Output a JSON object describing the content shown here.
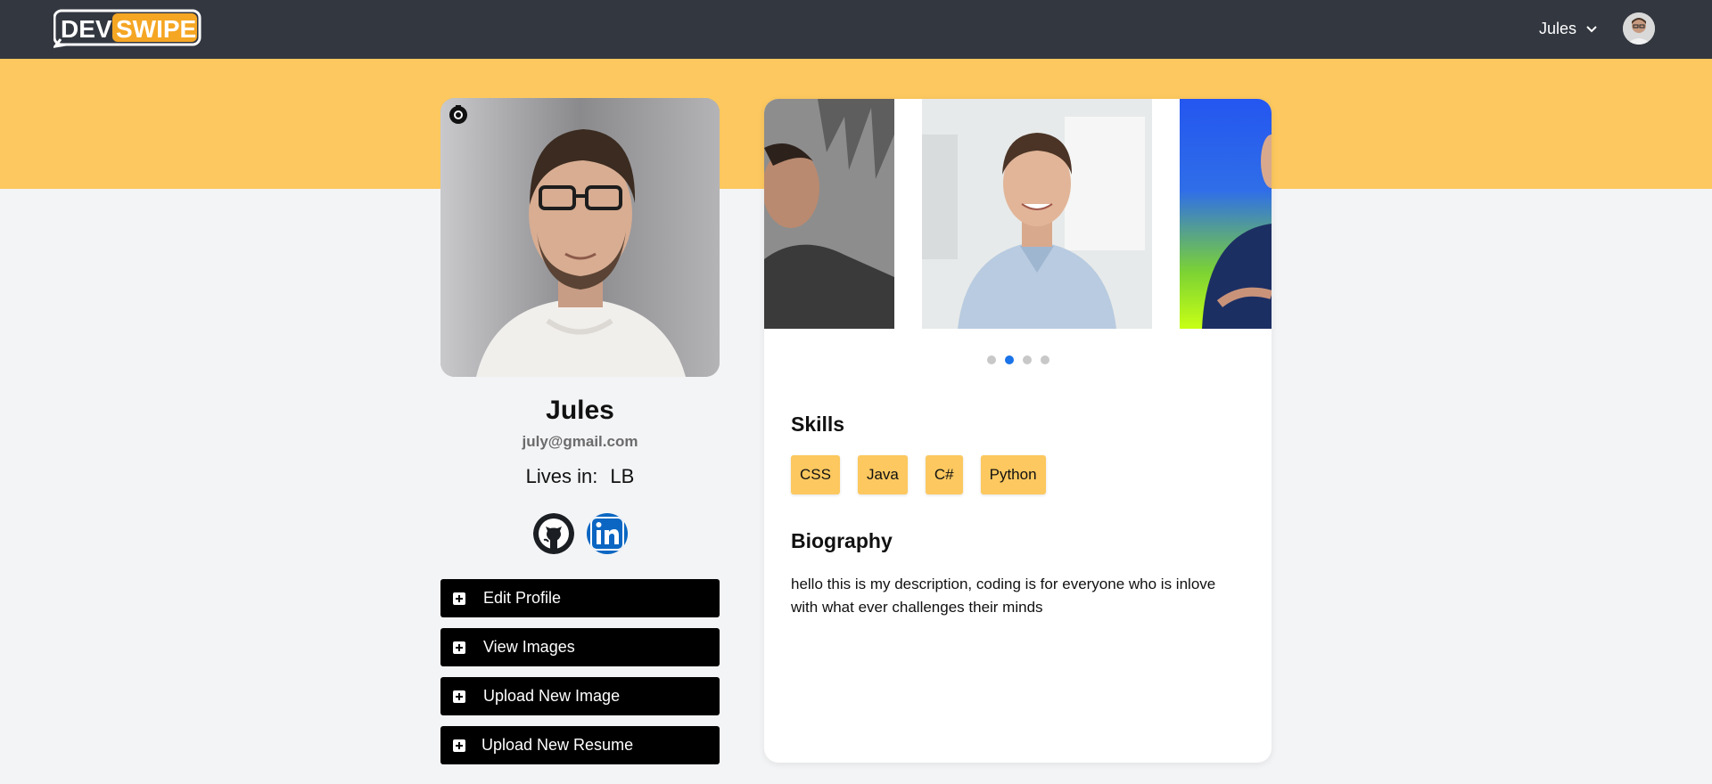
{
  "header": {
    "logo_text": "DEVSWIPE",
    "user_name": "Jules",
    "colors": {
      "bar": "#333740",
      "accent": "#fcc85f"
    }
  },
  "profile": {
    "name": "Jules",
    "email": "july@gmail.com",
    "lives_label": "Lives in:",
    "location": "LB",
    "socials": [
      "github-icon",
      "linkedin-icon"
    ]
  },
  "actions": {
    "edit_profile": "Edit Profile",
    "view_images": "View Images",
    "upload_image": "Upload New Image",
    "upload_resume": "Upload New Resume"
  },
  "gallery": {
    "total_slides": 4,
    "active_index": 1
  },
  "skills": {
    "title": "Skills",
    "items": [
      "CSS",
      "Java",
      "C#",
      "Python"
    ]
  },
  "biography": {
    "title": "Biography",
    "text": "hello this is my description, coding is for everyone who is inlove with what ever challenges their minds"
  }
}
